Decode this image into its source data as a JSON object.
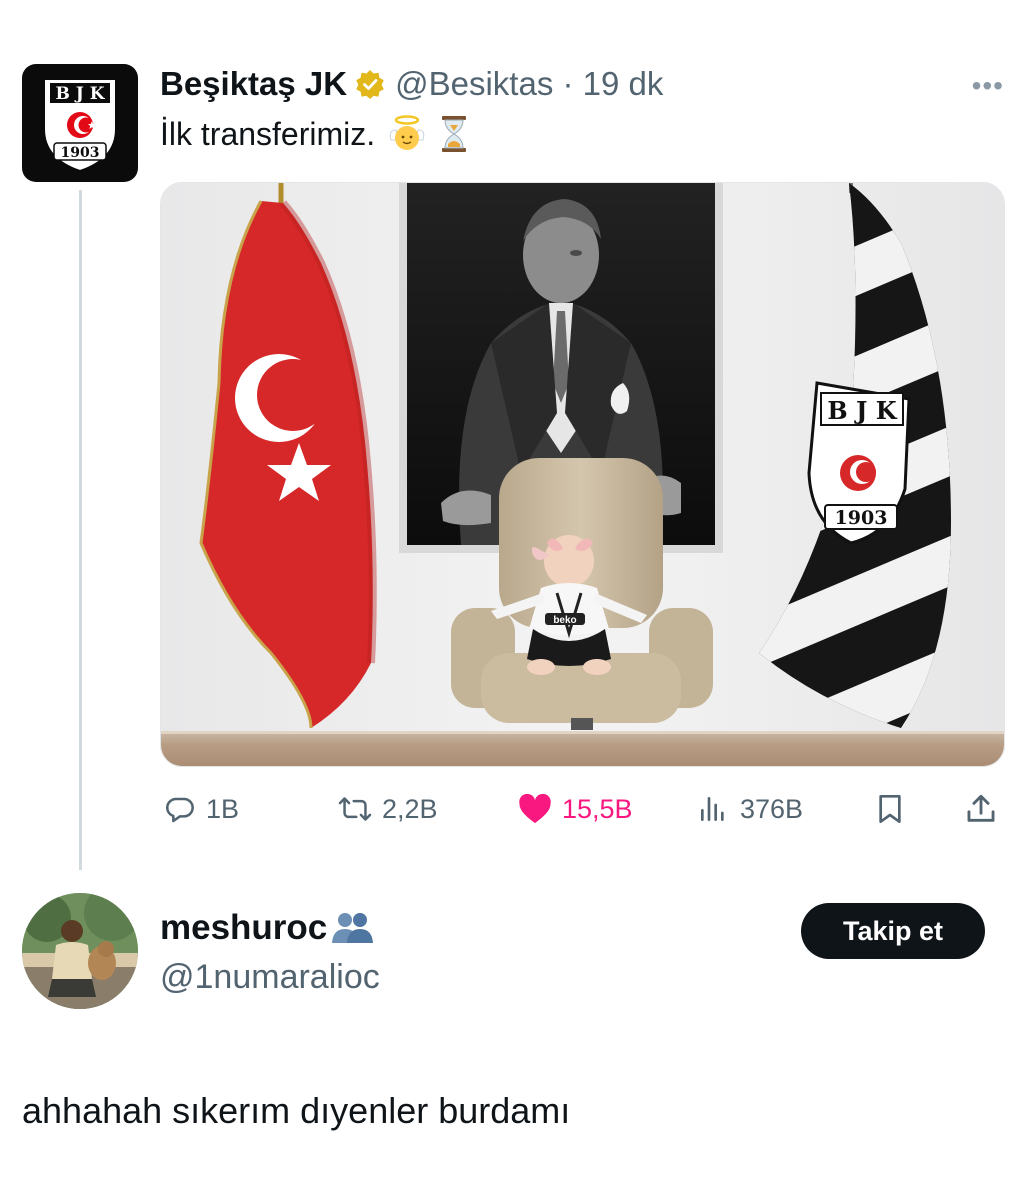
{
  "tweet": {
    "author_name": "Beşiktaş JK",
    "author_handle": "@Besiktas · 19 dk",
    "more_icon": "•••",
    "text": "İlk transferimiz.",
    "emoji": [
      "angel-emoji",
      "hourglass-emoji"
    ],
    "avatar_logo": {
      "letters": [
        "B",
        "J",
        "K"
      ],
      "year": "1903"
    },
    "media": {
      "flag_logo_letters": [
        "B",
        "J",
        "K"
      ],
      "flag_logo_year": "1903",
      "jersey_text": "beko"
    },
    "actions": {
      "reply": {
        "icon": "reply-icon",
        "count": "1B"
      },
      "retweet": {
        "icon": "retweet-icon",
        "count": "2,2B"
      },
      "like": {
        "icon": "heart-icon",
        "count": "15,5B"
      },
      "views": {
        "icon": "views-icon",
        "count": "376B"
      },
      "bookmark": {
        "icon": "bookmark-icon"
      },
      "share": {
        "icon": "share-icon"
      }
    }
  },
  "reply_user": {
    "name": "meshuroc",
    "badge_icon": "people-emoji",
    "handle": "@1numaralioc",
    "follow_label": "Takip et"
  },
  "reply_text": "ahhahah sıkerım dıyenler burdamı",
  "colors": {
    "text": "#0f1419",
    "muted": "#536471",
    "like": "#f91880",
    "verified_gold": "#e2b719",
    "button_bg": "#0f1419"
  }
}
